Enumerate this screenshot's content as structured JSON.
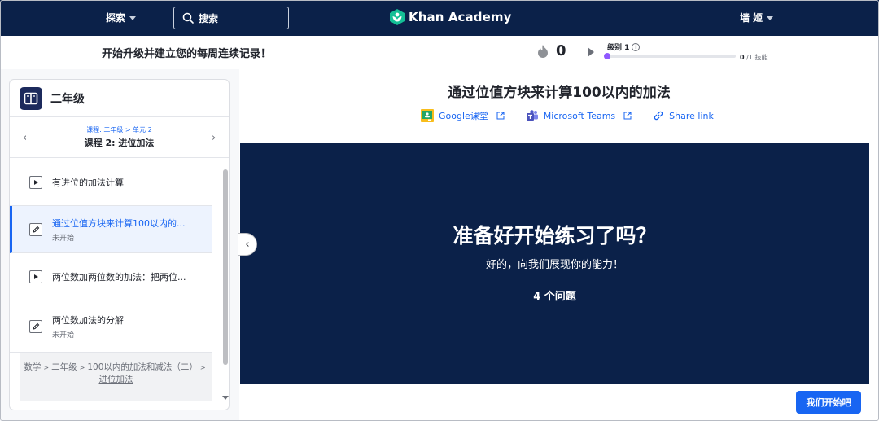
{
  "nav": {
    "explore": "探索",
    "search_placeholder": "搜索",
    "logo": "Khan Academy",
    "user": "墙 姬"
  },
  "streak": {
    "message": "开始升级并建立您的每周连续记录！",
    "count": "0",
    "level_label": "级别 1",
    "skills_done": "0",
    "skills_total": "/1 技能",
    "level_progress": 0
  },
  "sidebar": {
    "course_title": "二年级",
    "unit_crumb": "课程: 二年级 > 单元 2",
    "unit_title": "课程 2: 进位加法",
    "items": [
      {
        "title": "有进位的加法计算",
        "status": "",
        "type": "video"
      },
      {
        "title": "通过位值方块来计算100以内的...",
        "status": "未开始",
        "type": "exercise"
      },
      {
        "title": "两位数加两位数的加法：把两位...",
        "status": "",
        "type": "video"
      },
      {
        "title": "两位数加法的分解",
        "status": "未开始",
        "type": "exercise"
      }
    ],
    "breadcrumb": [
      "数学",
      "二年级",
      "100以内的加法和减法（二）",
      "进位加法"
    ]
  },
  "main": {
    "title": "通过位值方块来计算100以内的加法",
    "share": {
      "google": "Google课堂",
      "teams": "Microsoft Teams",
      "link": "Share link"
    },
    "practice_title": "准备好开始练习了吗？",
    "practice_sub": "好的，向我们展现你的能力！",
    "question_count": "4 个问题",
    "start_button": "我们开始吧"
  },
  "colors": {
    "nav_bg": "#0b2149",
    "accent": "#1865f2",
    "level_dot": "#9059ff"
  }
}
